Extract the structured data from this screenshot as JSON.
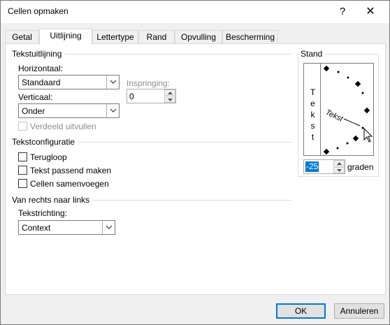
{
  "window": {
    "title": "Cellen opmaken",
    "help_label": "?",
    "close_label": "✕"
  },
  "tabs": [
    {
      "label": "Getal",
      "active": false
    },
    {
      "label": "Uitlijning",
      "active": true
    },
    {
      "label": "Lettertype",
      "active": false
    },
    {
      "label": "Rand",
      "active": false
    },
    {
      "label": "Opvulling",
      "active": false
    },
    {
      "label": "Bescherming",
      "active": false
    }
  ],
  "tekstuitlijning": {
    "heading": "Tekstuitlijning",
    "horizontaal_label": "Horizontaal:",
    "horizontaal_value": "Standaard",
    "inspringing_label": "Inspringing:",
    "inspringing_value": "0",
    "verticaal_label": "Verticaal:",
    "verticaal_value": "Onder",
    "verdeeld_label": "Verdeeld uitvullen",
    "verdeeld_checked": false
  },
  "tekstconfiguratie": {
    "heading": "Tekstconfiguratie",
    "options": [
      {
        "label": "Terugloop",
        "checked": false
      },
      {
        "label": "Tekst passend maken",
        "checked": false
      },
      {
        "label": "Cellen samenvoegen",
        "checked": false
      }
    ]
  },
  "rtl": {
    "heading": "Van rechts naar links",
    "tekstrichting_label": "Tekstrichting:",
    "tekstrichting_value": "Context"
  },
  "stand": {
    "heading": "Stand",
    "vertical_text": "Tekst",
    "dial_text": "Tekst",
    "degrees_value": "-25",
    "degrees_unit": "graden"
  },
  "footer": {
    "ok_label": "OK",
    "cancel_label": "Annuleren"
  },
  "icons": [
    "help-icon",
    "close-icon",
    "dropdown-arrow-icon",
    "spin-up-icon",
    "spin-down-icon",
    "orientation-dial-icon",
    "mouse-cursor-icon"
  ]
}
